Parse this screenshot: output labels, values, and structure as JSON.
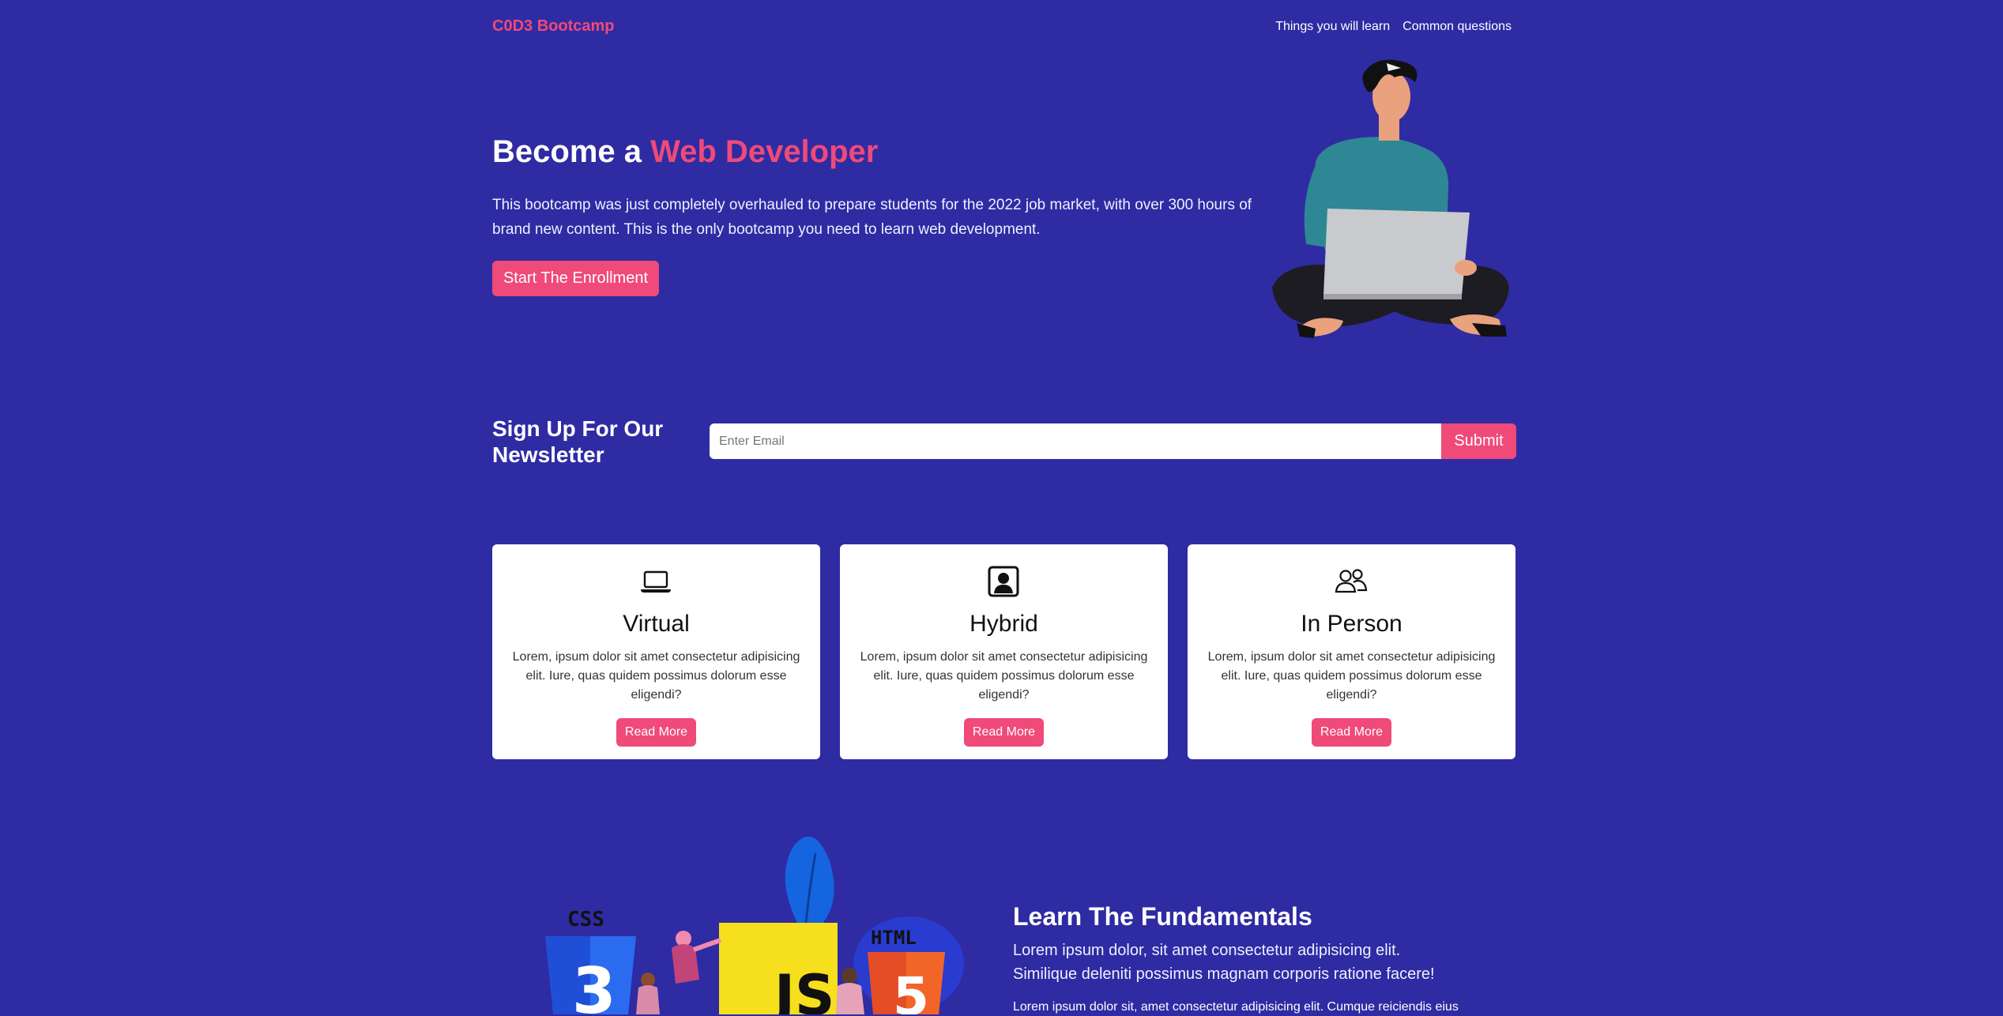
{
  "navbar": {
    "brand": "C0D3 Bootcamp",
    "links": [
      "Things you will learn",
      "Common questions"
    ]
  },
  "hero": {
    "title_prefix": "Become a ",
    "title_accent": "Web Developer",
    "text": "This bootcamp was just completely overhauled to prepare students for the 2022 job market, with over 300 hours of brand new content. This is the only bootcamp you need to learn web development.",
    "button": "Start The Enrollment"
  },
  "newsletter": {
    "title": "Sign Up For Our Newsletter",
    "placeholder": "Enter Email",
    "value": "",
    "button": "Submit"
  },
  "cards": [
    {
      "icon": "laptop-icon",
      "title": "Virtual",
      "text": "Lorem, ipsum dolor sit amet consectetur adipisicing elit. Iure, quas quidem possimus dolorum esse eligendi?",
      "button": "Read More"
    },
    {
      "icon": "person-badge-icon",
      "title": "Hybrid",
      "text": "Lorem, ipsum dolor sit amet consectetur adipisicing elit. Iure, quas quidem possimus dolorum esse eligendi?",
      "button": "Read More"
    },
    {
      "icon": "people-icon",
      "title": "In Person",
      "text": "Lorem, ipsum dolor sit amet consectetur adipisicing elit. Iure, quas quidem possimus dolorum esse eligendi?",
      "button": "Read More"
    }
  ],
  "fundamentals": {
    "title": "Learn The Fundamentals",
    "lead": "Lorem ipsum dolor, sit amet consectetur adipisicing elit. Similique deleniti possimus magnam corporis ratione facere!",
    "text": "Lorem ipsum dolor sit, amet consectetur adipisicing elit. Cumque reiciendis eius",
    "illustration_labels": [
      "CSS",
      "HTML",
      "JS"
    ]
  },
  "colors": {
    "background": "#2f2ba3",
    "accent": "#ef4a78",
    "card": "#ffffff"
  }
}
